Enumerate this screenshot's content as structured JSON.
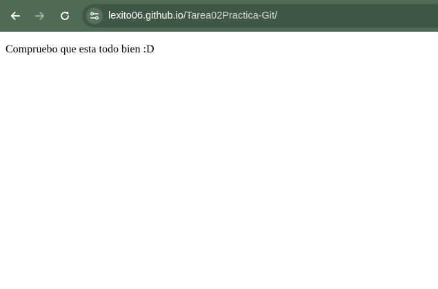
{
  "toolbar": {
    "back_icon": "arrow-left-icon",
    "forward_icon": "arrow-right-icon",
    "reload_icon": "reload-icon",
    "site_info_icon": "tune-icon",
    "url_host": "lexito06.github.io",
    "url_path": "/Tarea02Practica-Git/",
    "background_color": "#4f6b55"
  },
  "page": {
    "text": "Compruebo que esta todo bien :D"
  }
}
